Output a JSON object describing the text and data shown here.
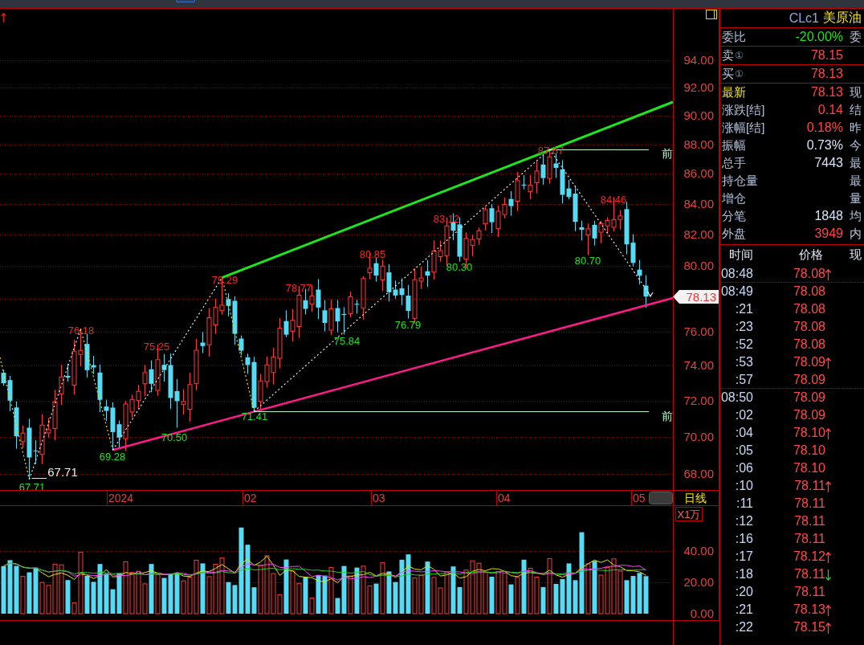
{
  "price_chart": {
    "axis_labels": [
      "94.00",
      "92.00",
      "90.00",
      "88.00",
      "86.00",
      "84.00",
      "82.00",
      "80.00",
      "76.00",
      "74.00",
      "72.00",
      "70.00",
      "68.00"
    ],
    "last_price": "78.13",
    "pivot_labels": [
      {
        "text": "67.71",
        "kind": "low"
      },
      {
        "text": "67.71",
        "kind": "note"
      },
      {
        "text": "76.18",
        "kind": "high"
      },
      {
        "text": "69.28",
        "kind": "low"
      },
      {
        "text": "75.25",
        "kind": "high"
      },
      {
        "text": "70.50",
        "kind": "low"
      },
      {
        "text": "79.29",
        "kind": "high"
      },
      {
        "text": "71.41",
        "kind": "low"
      },
      {
        "text": "78.77",
        "kind": "high"
      },
      {
        "text": "75.84",
        "kind": "low"
      },
      {
        "text": "80.85",
        "kind": "high"
      },
      {
        "text": "76.79",
        "kind": "low"
      },
      {
        "text": "83.12",
        "kind": "high"
      },
      {
        "text": "80.30",
        "kind": "low"
      },
      {
        "text": "87.67",
        "kind": "high"
      },
      {
        "text": "80.70",
        "kind": "low"
      },
      {
        "text": "84.46",
        "kind": "high"
      }
    ],
    "reference_lines": [
      {
        "label": "前"
      },
      {
        "label": "前"
      }
    ]
  },
  "date_axis": {
    "labels": [
      "2024",
      "02",
      "03",
      "04",
      "05"
    ],
    "period": "日线"
  },
  "volume_chart": {
    "unit": "X1万",
    "axis_labels": [
      "40.00",
      "20.00",
      "0.00"
    ]
  },
  "quote": {
    "symbol": "CLc1",
    "name": "美原油",
    "sections": [
      {
        "rows": [
          {
            "label": "委比",
            "value": "-20.00%",
            "color": "#22dd22",
            "column_3": "委",
            "highlighted": false
          }
        ]
      },
      {
        "rows": [
          {
            "label": "卖",
            "badge": "①",
            "value": "78.15",
            "color": "#ff4444",
            "highlighted": false
          }
        ]
      },
      {
        "rows": [
          {
            "label": "买",
            "badge": "①",
            "value": "78.13",
            "color": "#ff4444",
            "highlighted": false
          }
        ]
      },
      {
        "rows": [
          {
            "label": "最新",
            "value": "78.13",
            "color": "#ff4444",
            "column_3": "现",
            "highlighted": true
          },
          {
            "label": "涨跌[结]",
            "value": "0.14",
            "color": "#ff4444",
            "column_3": "结",
            "highlighted": false
          },
          {
            "label": "涨幅[结]",
            "value": "0.18%",
            "color": "#ff4444",
            "column_3": "昨",
            "highlighted": false
          },
          {
            "label": "振幅",
            "value": "0.73%",
            "color": "#d8e0f4",
            "column_3": "今",
            "highlighted": false
          },
          {
            "label": "总手",
            "value": "7443",
            "color": "#d8e0f4",
            "column_3": "最",
            "highlighted": false
          },
          {
            "label": "持仓量",
            "column_3": "最",
            "highlighted": false
          },
          {
            "label": "增仓",
            "column_3": "量",
            "highlighted": false
          },
          {
            "label": "分笔",
            "value": "1848",
            "color": "#d8e0f4",
            "column_3": "均",
            "highlighted": false
          },
          {
            "label": "外盘",
            "value": "3949",
            "color": "#ff4444",
            "column_3": "内",
            "highlighted": false
          }
        ]
      }
    ]
  },
  "trades": {
    "columns": [
      "时间",
      "价格",
      "现"
    ],
    "rows": [
      {
        "time": "08:48",
        "price": "78.08",
        "uptick": true,
        "downtick": false,
        "new_minute": false
      },
      {
        "time": "08:49",
        "price": "78.08",
        "uptick": false,
        "downtick": false,
        "new_minute": true
      },
      {
        "time": ":21",
        "price": "78.08",
        "uptick": false,
        "downtick": false,
        "new_minute": false
      },
      {
        "time": ":23",
        "price": "78.08",
        "uptick": false,
        "downtick": false,
        "new_minute": false
      },
      {
        "time": ":52",
        "price": "78.08",
        "uptick": false,
        "downtick": false,
        "new_minute": false
      },
      {
        "time": ":53",
        "price": "78.09",
        "uptick": true,
        "downtick": false,
        "new_minute": false
      },
      {
        "time": ":57",
        "price": "78.09",
        "uptick": false,
        "downtick": false,
        "new_minute": false
      },
      {
        "time": "08:50",
        "price": "78.09",
        "uptick": false,
        "downtick": false,
        "new_minute": true
      },
      {
        "time": ":02",
        "price": "78.09",
        "uptick": false,
        "downtick": false,
        "new_minute": false
      },
      {
        "time": ":04",
        "price": "78.10",
        "uptick": true,
        "downtick": false,
        "new_minute": false
      },
      {
        "time": ":05",
        "price": "78.10",
        "uptick": false,
        "downtick": false,
        "new_minute": false
      },
      {
        "time": ":06",
        "price": "78.10",
        "uptick": false,
        "downtick": false,
        "new_minute": false
      },
      {
        "time": ":10",
        "price": "78.11",
        "uptick": true,
        "downtick": false,
        "new_minute": false
      },
      {
        "time": ":11",
        "price": "78.11",
        "uptick": false,
        "downtick": false,
        "new_minute": false
      },
      {
        "time": ":12",
        "price": "78.11",
        "uptick": false,
        "downtick": false,
        "new_minute": false
      },
      {
        "time": ":16",
        "price": "78.11",
        "uptick": false,
        "downtick": false,
        "new_minute": false
      },
      {
        "time": ":17",
        "price": "78.12",
        "uptick": true,
        "downtick": false,
        "new_minute": false
      },
      {
        "time": ":18",
        "price": "78.11",
        "uptick": false,
        "downtick": true,
        "new_minute": false
      },
      {
        "time": ":20",
        "price": "78.11",
        "uptick": false,
        "downtick": false,
        "new_minute": false
      },
      {
        "time": ":21",
        "price": "78.13",
        "uptick": true,
        "downtick": false,
        "new_minute": false
      },
      {
        "time": ":22",
        "price": "78.15",
        "uptick": true,
        "downtick": false,
        "new_minute": false
      }
    ]
  }
}
